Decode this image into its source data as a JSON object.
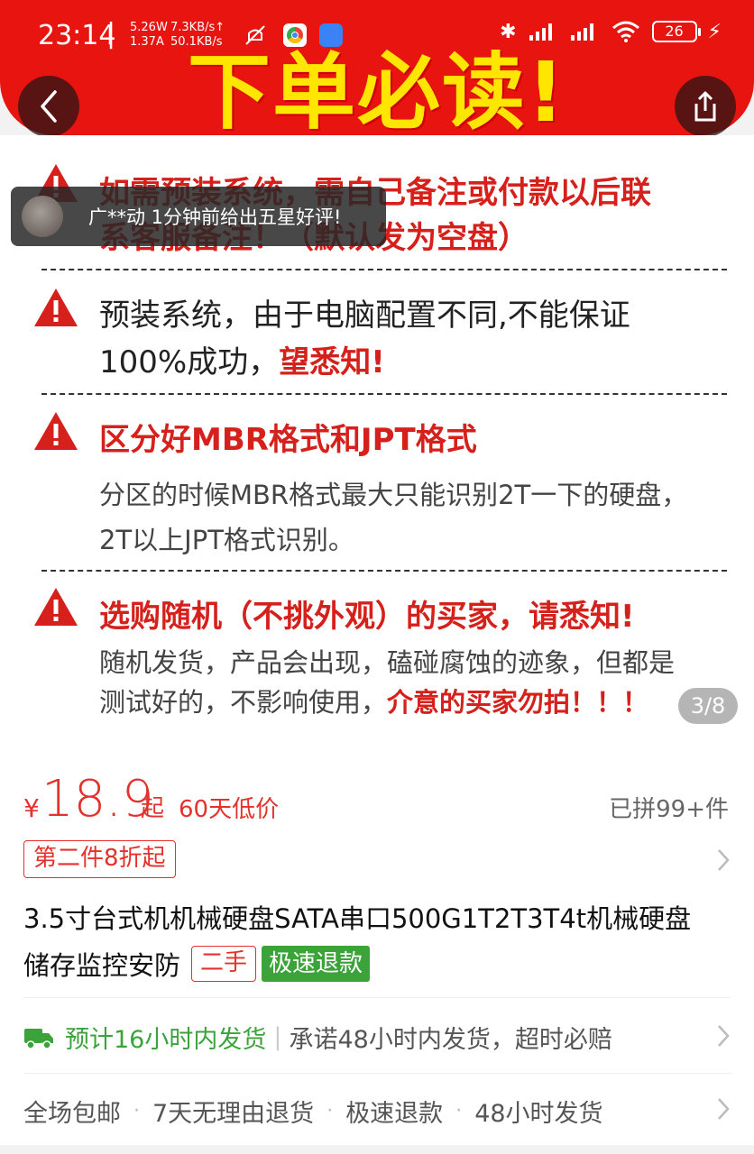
{
  "status_bar": {
    "time": "23:14",
    "separator": "|",
    "power_w": "5.26W",
    "power_a": "1.37A",
    "up_speed": "7.3KB/s↑",
    "down_speed": "50.1KB/s",
    "battery": "26"
  },
  "banner": {
    "title": "下单必读!"
  },
  "toast": {
    "text": "广**动 1分钟前给出五星好评!"
  },
  "notices": [
    {
      "line1": "如需预装系统，需自己备注或付款以后联",
      "line2": "系客服备注！（默认发为空盘）"
    },
    {
      "line1": "预装系统，由于电脑配置不同,不能保证",
      "line2a": "100%成功，",
      "line2b": "望悉知!"
    },
    {
      "head": "区分好MBR格式和JPT格式",
      "line1": "分区的时候MBR格式最大只能识别2T一下的硬盘，",
      "line2": "2T以上JPT格式识别。"
    },
    {
      "head": "选购随机（不挑外观）的买家，请悉知!",
      "line1": "随机发货，产品会出现，磕碰腐蚀的迹象，但都是",
      "line2a": "测试好的，不影响使用，",
      "line2b": "介意的买家勿拍！！！"
    }
  ],
  "pager": "3/8",
  "price": {
    "currency": "¥",
    "value": "18.9",
    "suffix": "起",
    "low_tag": "60天低价",
    "sold": "已拼99+件"
  },
  "coupon": "第二件8折起",
  "product": {
    "title_line1": "3.5寸台式机机械硬盘SATA串口500G1T2T3T4t机械硬盘",
    "title_line2": "储存监控安防",
    "tag_used": "二手",
    "tag_refund": "极速退款"
  },
  "shipping": {
    "estimate": "预计16小时内发货",
    "separator": "|",
    "promise": "承诺48小时内发货，超时必赔"
  },
  "services": [
    "全场包邮",
    "7天无理由退货",
    "极速退款",
    "48小时发货"
  ],
  "colors": {
    "brand_red": "#e8140f",
    "banner_yellow": "#ffe600",
    "price_red": "#e4312b",
    "green": "#3ca33b"
  }
}
